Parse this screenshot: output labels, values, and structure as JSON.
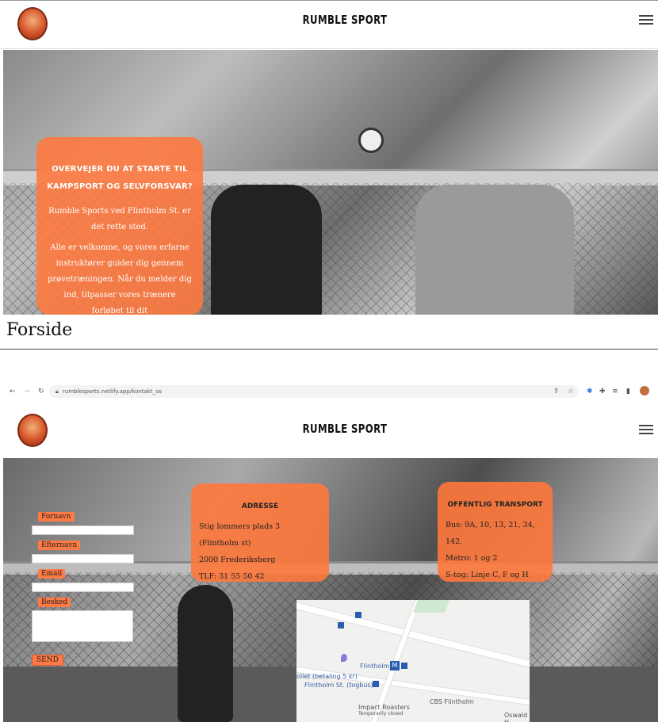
{
  "site": {
    "brand": "RUMBLE SPORT"
  },
  "forside": {
    "hero_card": {
      "heading": "OVERVEJER DU AT STARTE TIL KAMPSPORT OG SELVFORSVAR?",
      "p1": "Rumble Sports ved Flintholm St. er det rette sted.",
      "p2": "Alle er velkomne, og vores erfarne instruktører guider dig gennem prøvetræningen. Når du melder dig ind, tilpasser vores trænere forløbet til dit"
    },
    "caption": "Forside"
  },
  "browser": {
    "url": "rumblesports.netlify.app/kontakt_os"
  },
  "kontakt": {
    "form": {
      "firstname_label": "Fornavn",
      "lastname_label": "Efternavn",
      "email_label": "Email",
      "message_label": "Besked",
      "send_label": "SEND"
    },
    "address": {
      "heading": "ADRESSE",
      "line1": "Stig lommers plads 3 (Flintholm st)",
      "line2": "2000 Frederiksberg",
      "phone": "TLF: 31 55 50 42"
    },
    "transport": {
      "heading": "OFFENTLIG TRANSPORT",
      "bus": "Bus: 9A, 10, 13, 21, 34, 142.",
      "metro": "Metro: 1 og 2",
      "stog": "S-tog: Linje C, F og H"
    },
    "map": {
      "flintholm": "Flintholm",
      "toilet": "oilet (betaling 5 kr)",
      "station": "Flintholm St. (togbus)",
      "impact": "Impact Roasters",
      "impact_sub": "Temporarily closed",
      "cbs": "CBS Flintholm",
      "oswald": "Oswald H"
    }
  },
  "colors": {
    "accent": "#ff7a44"
  }
}
